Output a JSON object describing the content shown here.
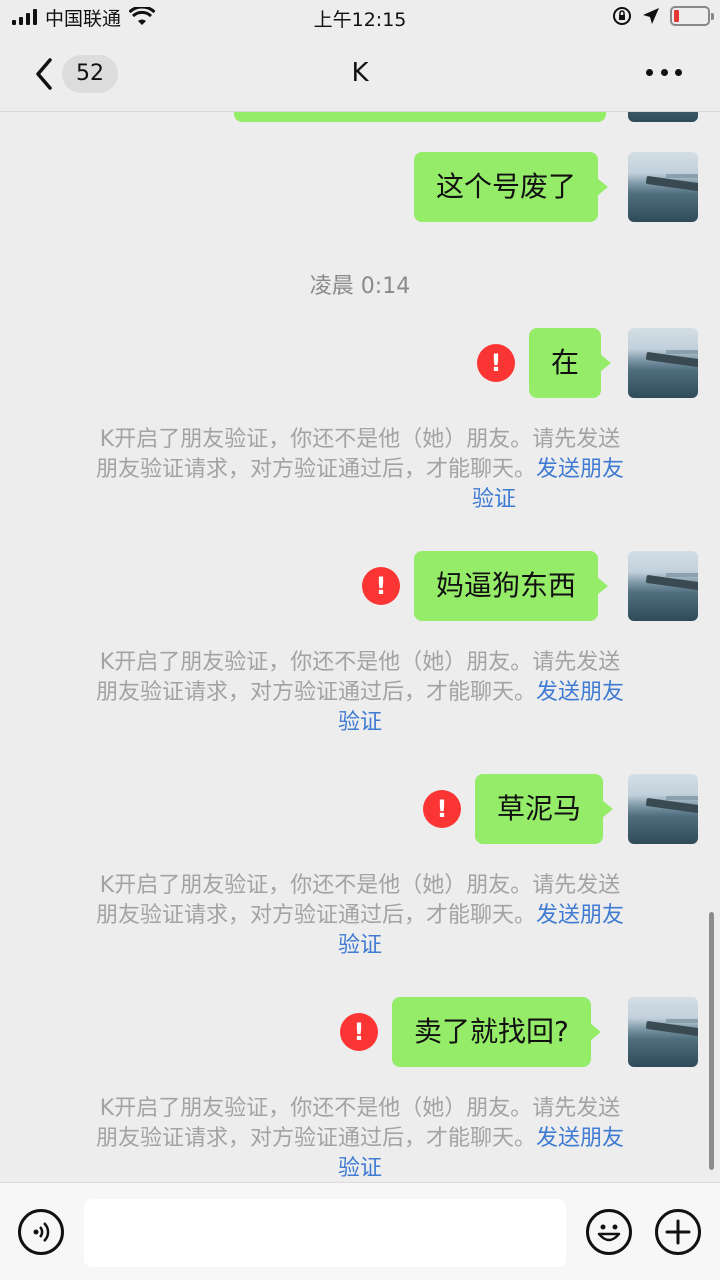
{
  "status_bar": {
    "carrier": "中国联通",
    "time": "上午12:15"
  },
  "nav": {
    "back_count": "52",
    "title": "K"
  },
  "chat": {
    "messages": [
      {
        "text": "这个号废了",
        "failed": false
      },
      {
        "text": "在",
        "failed": true
      },
      {
        "text": "妈逼狗东西",
        "failed": true
      },
      {
        "text": "草泥马",
        "failed": true
      },
      {
        "text": "卖了就找回?",
        "failed": true
      }
    ],
    "timestamp": "凌晨 0:14",
    "system_notice": {
      "line1": "K开启了朋友验证，你还不是他（她）朋友。请先发送",
      "line2_prefix": "朋友验证请求，对方验证通过后，才能聊天。",
      "link_part1": "发送朋友",
      "link_part2": "验证"
    },
    "error_glyph": "!"
  },
  "colors": {
    "bubble": "#95ec69",
    "error": "#fa3534",
    "link": "#3f7bd2",
    "background": "#ededed"
  },
  "icons": {
    "back": "chevron-left-icon",
    "more": "more-icon",
    "voice": "voice-icon",
    "emoji": "emoji-icon",
    "plus": "plus-icon"
  }
}
